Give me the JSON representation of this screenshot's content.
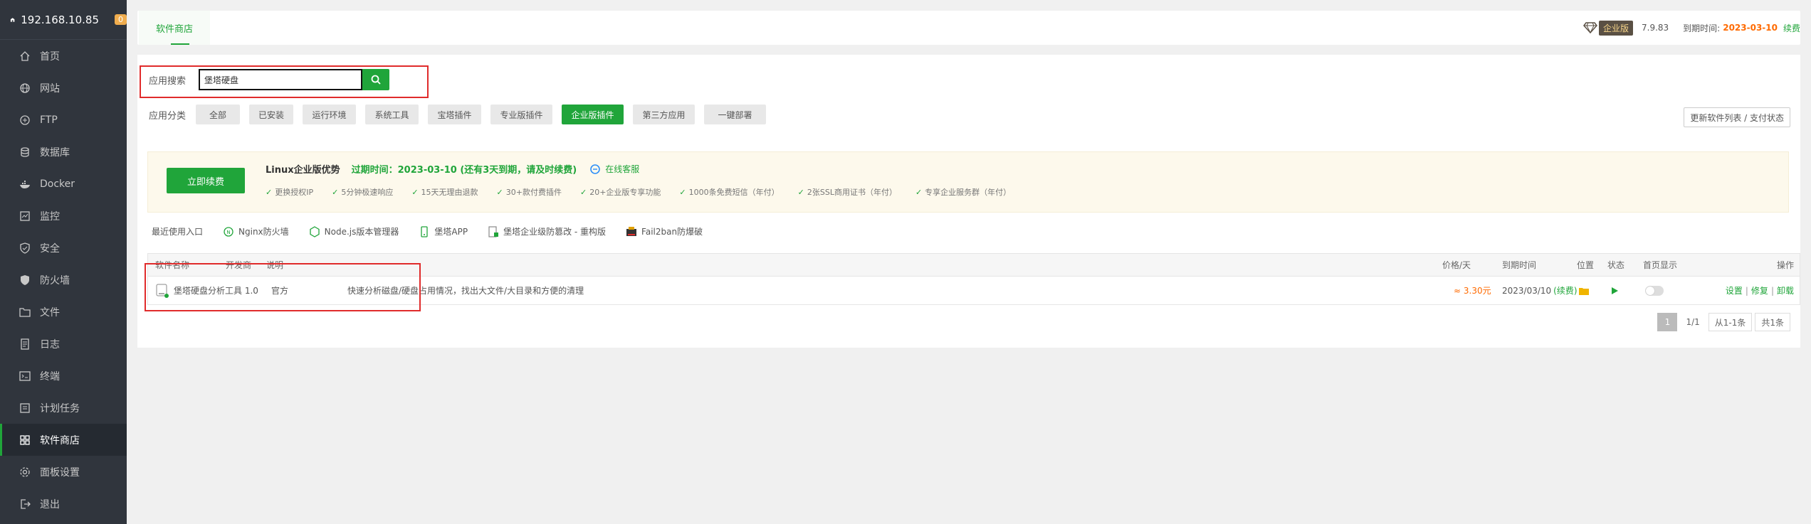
{
  "sidebar": {
    "host": "192.168.10.85",
    "badge": "0",
    "items": [
      {
        "label": "首页",
        "icon": "home-icon"
      },
      {
        "label": "网站",
        "icon": "globe-icon"
      },
      {
        "label": "FTP",
        "icon": "ftp-icon"
      },
      {
        "label": "数据库",
        "icon": "database-icon"
      },
      {
        "label": "Docker",
        "icon": "docker-icon"
      },
      {
        "label": "监控",
        "icon": "monitor-icon"
      },
      {
        "label": "安全",
        "icon": "shield-icon"
      },
      {
        "label": "防火墙",
        "icon": "firewall-icon"
      },
      {
        "label": "文件",
        "icon": "folder-icon"
      },
      {
        "label": "日志",
        "icon": "log-icon"
      },
      {
        "label": "终端",
        "icon": "terminal-icon"
      },
      {
        "label": "计划任务",
        "icon": "clock-icon"
      },
      {
        "label": "软件商店",
        "icon": "grid-icon",
        "active": true
      },
      {
        "label": "面板设置",
        "icon": "gear-icon"
      },
      {
        "label": "退出",
        "icon": "logout-icon"
      }
    ]
  },
  "topbar": {
    "tab": "软件商店",
    "edition": "企业版",
    "version": "7.9.83",
    "expire_label": "到期时间:",
    "expire_date": "2023-03-10",
    "renew": "续费"
  },
  "search": {
    "label": "应用搜索",
    "value": "堡塔硬盘"
  },
  "categories": {
    "label": "应用分类",
    "items": [
      "全部",
      "已安装",
      "运行环境",
      "系统工具",
      "宝塔插件",
      "专业版插件",
      "企业版插件",
      "第三方应用",
      "一键部署"
    ],
    "active_index": 6,
    "update_button": "更新软件列表 / 支付状态"
  },
  "promo": {
    "buy_button": "立即续费",
    "title": "Linux企业版优势",
    "expire_text": "过期时间：2023-03-10 (还有3天到期，请及时续费)",
    "online_service": "在线客服",
    "features": [
      "更换授权IP",
      "5分钟极速响应",
      "15天无理由退款",
      "30+款付费插件",
      "20+企业版专享功能",
      "1000条免费短信（年付）",
      "2张SSL商用证书（年付）",
      "专享企业服务群（年付）"
    ]
  },
  "recent": {
    "label": "最近使用入口",
    "items": [
      {
        "label": "Nginx防火墙",
        "icon": "waf-icon"
      },
      {
        "label": "Node.js版本管理器",
        "icon": "nodejs-icon"
      },
      {
        "label": "堡塔APP",
        "icon": "app-icon"
      },
      {
        "label": "堡塔企业级防篡改 - 重构版",
        "icon": "tamper-icon"
      },
      {
        "label": "Fail2ban防爆破",
        "icon": "fail2ban-icon"
      }
    ]
  },
  "table": {
    "headers": {
      "name": "软件名称",
      "developer": "开发商",
      "desc": "说明",
      "price": "价格/天",
      "expire": "到期时间",
      "location": "位置",
      "status": "状态",
      "homepage": "首页显示",
      "actions": "操作"
    },
    "rows": [
      {
        "name": "堡塔硬盘分析工具 1.0",
        "developer": "官方",
        "desc": "快速分析磁盘/硬盘占用情况，找出大文件/大目录和方便的清理",
        "price": "≈ 3.30元",
        "expire_date": "2023/03/10",
        "renew": "(续费)",
        "actions": [
          "设置",
          "修复",
          "卸载"
        ]
      }
    ]
  },
  "pager": {
    "current": "1",
    "pages": "1/1",
    "range": "从1-1条",
    "total": "共1条"
  },
  "colors": {
    "accent": "#20a53a",
    "sidebar_bg": "#30353d",
    "highlight_box": "#e02b2b",
    "price": "#ff6a00"
  }
}
